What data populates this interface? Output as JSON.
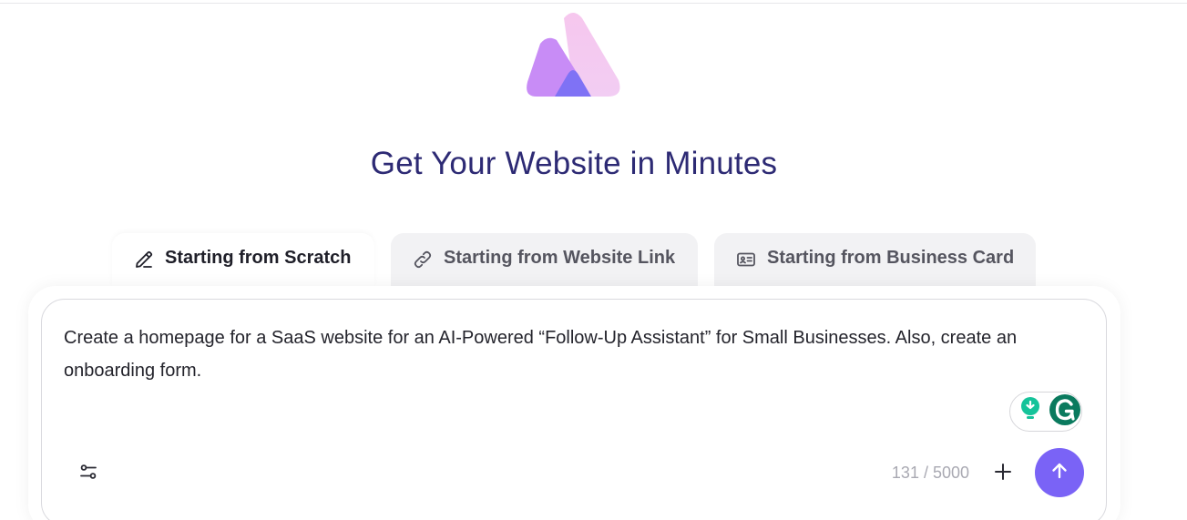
{
  "hero": {
    "logo": "app-logo-icon",
    "title": "Get Your Website in Minutes"
  },
  "tabs": [
    {
      "label": "Starting from Scratch",
      "icon": "pencil-icon",
      "active": true
    },
    {
      "label": "Starting from Website Link",
      "icon": "link-icon",
      "active": false
    },
    {
      "label": "Starting from Business Card",
      "icon": "id-card-icon",
      "active": false
    }
  ],
  "prompt": {
    "value": "Create a homepage for a SaaS website for an AI-Powered “Follow-Up Assistant” for Small Businesses. Also, create an onboarding form.",
    "counter": "131 / 5000"
  },
  "toolbar": {
    "settings_icon": "sliders-icon",
    "plus_icon": "plus-icon",
    "send_icon": "arrow-up-icon",
    "grammarly_icons": [
      "lightbulb-icon",
      "grammarly-icon"
    ]
  },
  "colors": {
    "title": "#2d2a74",
    "accent": "#7a63f6",
    "grammarly_green": "#15c39a",
    "grammarly_dark": "#0a7a5e"
  }
}
